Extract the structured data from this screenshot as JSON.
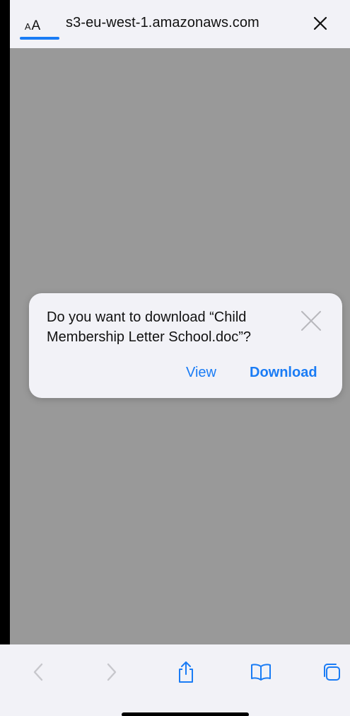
{
  "address_bar": {
    "reader_label_small": "A",
    "reader_label_large": "A",
    "url": "s3-eu-west-1.amazonaws.com",
    "close_icon": "close-icon"
  },
  "dialog": {
    "message": "Do you want to download “Child Membership Letter School.doc”?",
    "close_icon": "close-icon",
    "view_label": "View",
    "download_label": "Download"
  },
  "toolbar": {
    "items": [
      {
        "icon": "back-chevron-icon",
        "enabled": false
      },
      {
        "icon": "forward-chevron-icon",
        "enabled": false
      },
      {
        "icon": "share-icon",
        "enabled": true
      },
      {
        "icon": "bookmarks-icon",
        "enabled": true
      },
      {
        "icon": "tabs-icon",
        "enabled": true
      }
    ]
  },
  "colors": {
    "accent": "#1a7cf5",
    "page_background": "#999999",
    "bar_background": "#f2f2f7",
    "disabled_icon": "#c7c7cc"
  }
}
